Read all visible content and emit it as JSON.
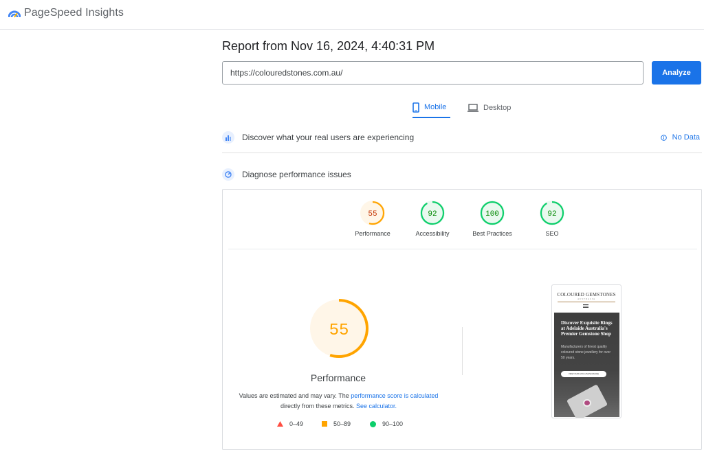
{
  "app": {
    "name": "PageSpeed Insights",
    "colors": {
      "accent": "#1a73e8",
      "average": "#ffa400",
      "good": "#0cce6b",
      "poor": "#ff4e42"
    }
  },
  "report": {
    "title": "Report from Nov 16, 2024, 4:40:31 PM",
    "url": "https://colouredstones.com.au/",
    "analyze_label": "Analyze"
  },
  "tabs": [
    {
      "label": "Mobile",
      "icon": "smartphone-icon",
      "selected": true
    },
    {
      "label": "Desktop",
      "icon": "laptop-icon",
      "selected": false
    }
  ],
  "sections": {
    "real_users": {
      "label": "Discover what your real users are experiencing",
      "status": "No Data"
    },
    "diagnose": {
      "label": "Diagnose performance issues"
    }
  },
  "scores": [
    {
      "label": "Performance",
      "value": 55,
      "rating": "average"
    },
    {
      "label": "Accessibility",
      "value": 92,
      "rating": "good"
    },
    {
      "label": "Best Practices",
      "value": 100,
      "rating": "good"
    },
    {
      "label": "SEO",
      "value": 92,
      "rating": "good"
    }
  ],
  "performance": {
    "value": "55",
    "label": "Performance",
    "note_prefix": "Values are estimated and may vary. The",
    "note_link1": "performance score is calculated",
    "note_middle": "directly from these metrics.",
    "note_link2": "See calculator."
  },
  "legend": [
    {
      "range": "0–49",
      "shape": "triangle"
    },
    {
      "range": "50–89",
      "shape": "square"
    },
    {
      "range": "90–100",
      "shape": "circle"
    }
  ],
  "screenshot": {
    "brand": "COLOURED GEMSTONES",
    "brand_sub": "AUSTRALIA",
    "hero_title": "Discover Exquisite Rings at Adelaide Australia's Premier Gemstone Shop",
    "hero_text": "Manufacturers of finest quality coloured stone jewellery for over 50 years.",
    "hero_button": "VIEW OUR EXCLUSIVE RANGE"
  }
}
